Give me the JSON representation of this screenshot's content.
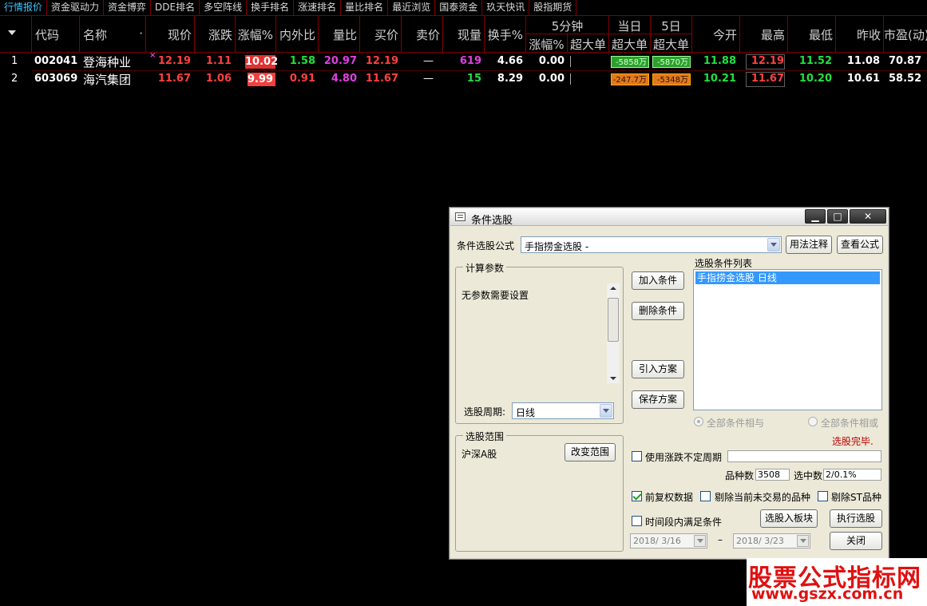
{
  "tabs": [
    "行情报价",
    "资金驱动力",
    "资金博弈",
    "DDE排名",
    "多空阵线",
    "换手排名",
    "涨速排名",
    "量比排名",
    "最近浏览",
    "国泰资金",
    "玖天快讯",
    "股指期货"
  ],
  "columns": {
    "code": "代码",
    "name": "名称",
    "price": "现价",
    "change": "涨跌",
    "pct": "涨幅%",
    "inout": "内外比",
    "volratio": "量比",
    "bid": "买价",
    "ask": "卖价",
    "vol": "现量",
    "turnover": "换手%",
    "min5_group": "5分钟",
    "min5_pct": "涨幅%",
    "min5_big": "超大单",
    "today_group": "当日",
    "today_big": "超大单",
    "day5_group": "5日",
    "day5_big": "超大单",
    "open": "今开",
    "high": "最高",
    "low": "最低",
    "prev": "昨收",
    "pe": "市盈(动)"
  },
  "rows": [
    {
      "idx": "1",
      "code": "002041",
      "name": "登海种业",
      "mark": "×",
      "price": "12.19",
      "change": "1.11",
      "pct": "10.02",
      "inout": "1.58",
      "volratio": "20.97",
      "bid": "12.19",
      "ask": "—",
      "vol": "619",
      "turnover": "4.66",
      "min5_pct": "0.00",
      "today_big": "-5858万",
      "day5_big": "-5870万",
      "open": "11.88",
      "high": "12.19",
      "low": "11.52",
      "prev": "11.08",
      "pe": "70.87"
    },
    {
      "idx": "2",
      "code": "603069",
      "name": "海汽集团",
      "mark": "",
      "price": "11.67",
      "change": "1.06",
      "pct": "9.99",
      "inout": "0.91",
      "volratio": "4.80",
      "bid": "11.67",
      "ask": "—",
      "vol": "15",
      "turnover": "8.29",
      "min5_pct": "0.00",
      "today_big": "-247.7万",
      "day5_big": "-5348万",
      "open": "10.21",
      "high": "11.67",
      "low": "10.20",
      "prev": "10.61",
      "pe": "58.52"
    }
  ],
  "dialog": {
    "title": "条件选股",
    "formula_label": "条件选股公式",
    "formula_value": "手指捞金选股 -",
    "usage_btn": "用法注释",
    "view_btn": "查看公式",
    "params_title": "计算参数",
    "params_text": "无参数需要设置",
    "period_label": "选股周期:",
    "period_value": "日线",
    "scope_title": "选股范围",
    "scope_value": "沪深A股",
    "change_scope_btn": "改变范围",
    "add_btn": "加入条件",
    "del_btn": "删除条件",
    "import_btn": "引入方案",
    "save_btn": "保存方案",
    "list_title": "选股条件列表",
    "list_items": [
      "手指捞金选股  日线"
    ],
    "radio_and": "全部条件相与",
    "radio_or": "全部条件相或",
    "status": "选股完毕.",
    "use_unfixed": "使用涨跌不定周期",
    "count_label": "品种数",
    "count_value": "3508",
    "selected_label": "选中数",
    "selected_value": "2/0.1%",
    "pre_adjust": "前复权数据",
    "exclude_untraded": "剔除当前未交易的品种",
    "exclude_st": "剔除ST品种",
    "period_satisfy": "时间段内满足条件",
    "to_block_btn": "选股入板块",
    "run_btn": "执行选股",
    "date_from": "2018/ 3/16",
    "date_sep": "–",
    "date_to": "2018/ 3/23",
    "close_btn": "关闭"
  },
  "watermark": {
    "line1": "股票公式指标网",
    "line2": "www.gszx.com.cn"
  },
  "colors": {
    "up": "#ff4040",
    "down": "#20e040",
    "grid": "#800000",
    "selection": "#3399ff"
  }
}
